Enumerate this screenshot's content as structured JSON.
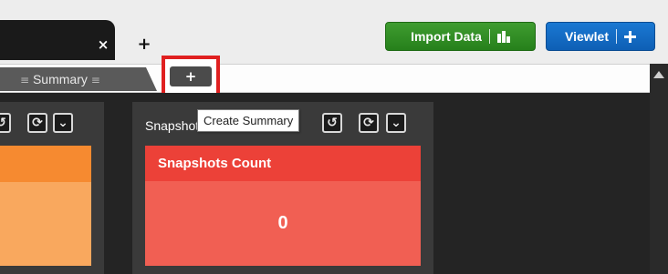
{
  "tabs": {
    "close_label": "×",
    "new_tab_label": "+"
  },
  "header": {
    "import_label": "Import Data",
    "viewlet_label": "Viewlet"
  },
  "subtabs": {
    "summary_label": "Summary",
    "create_summary_label": "+"
  },
  "panels": {
    "right_title": "Snapshots Count",
    "count_card_title": "Snapshots Count",
    "count_value": "0"
  },
  "tooltip": {
    "text": "Create Summary"
  },
  "colors": {
    "import_button": "#2e8a22",
    "viewlet_button": "#1168c6",
    "highlight": "#e02020",
    "card_red_header": "#ec4138",
    "card_red_body": "#f15f53",
    "card_orange_header": "#f68a30",
    "card_orange_body": "#f9a85e"
  },
  "icons": [
    "close-icon",
    "plus-icon",
    "bar-chart-icon",
    "popout-icon",
    "undo-icon",
    "refresh-icon",
    "chevron-down-icon",
    "drag-handle-icon"
  ]
}
